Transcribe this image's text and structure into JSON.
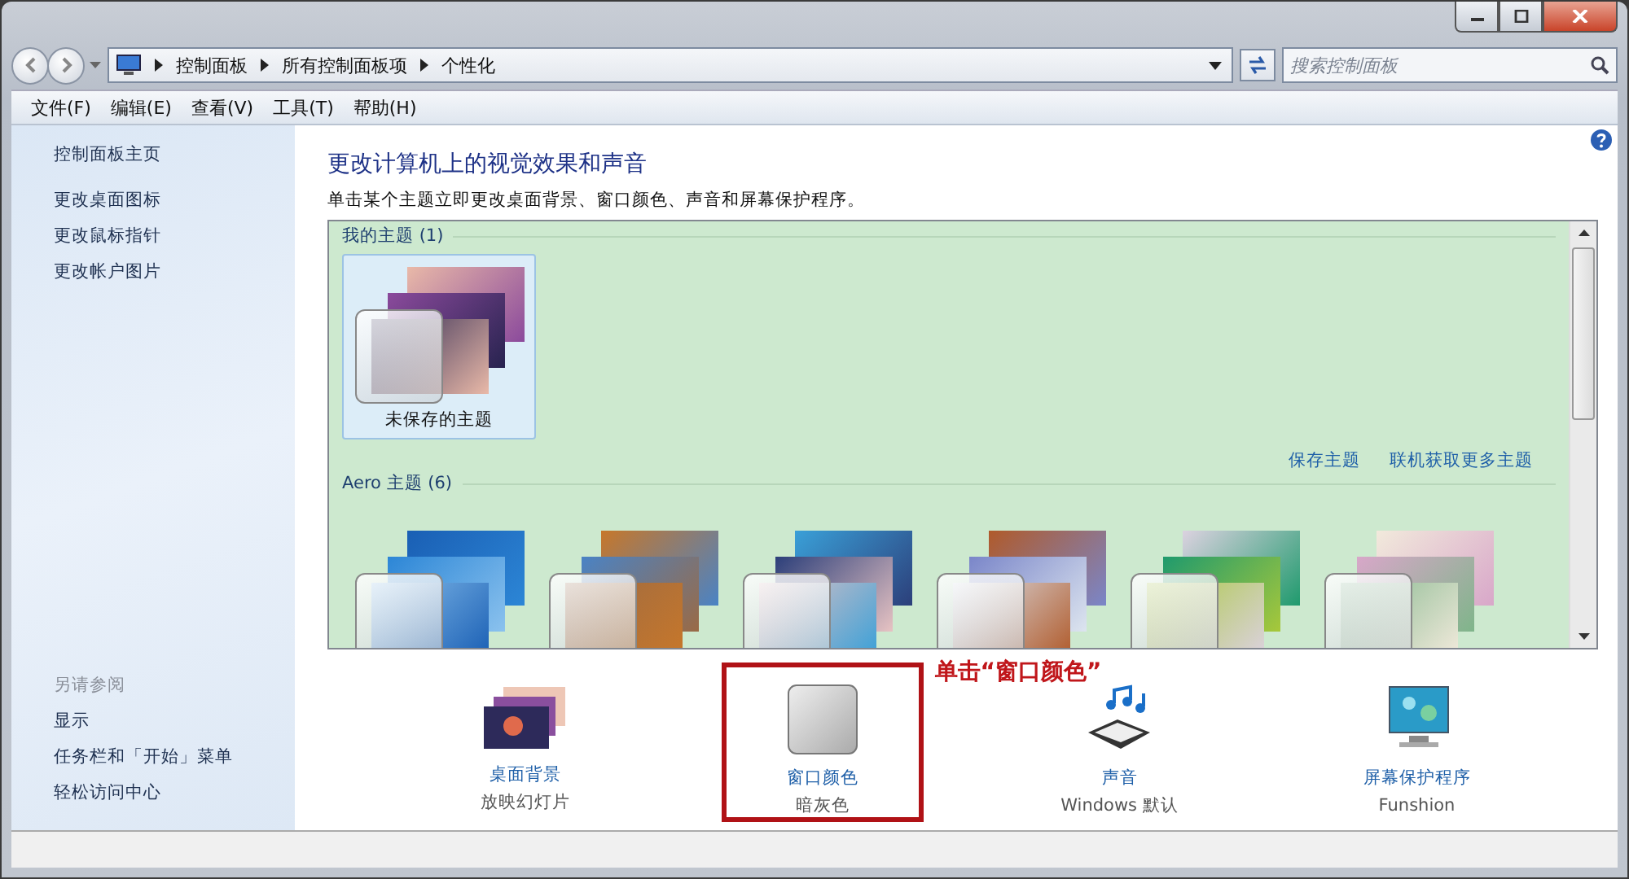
{
  "address_bar": {
    "crumbs": [
      "控制面板",
      "所有控制面板项",
      "个性化"
    ],
    "search_placeholder": "搜索控制面板"
  },
  "menu": [
    "文件(F)",
    "编辑(E)",
    "查看(V)",
    "工具(T)",
    "帮助(H)"
  ],
  "sidebar": {
    "home": "控制面板主页",
    "links": [
      "更改桌面图标",
      "更改鼠标指针",
      "更改帐户图片"
    ],
    "see_also_title": "另请参阅",
    "see_also": [
      "显示",
      "任务栏和「开始」菜单",
      "轻松访问中心"
    ]
  },
  "main": {
    "title": "更改计算机上的视觉效果和声音",
    "subtitle": "单击某个主题立即更改桌面背景、窗口颜色、声音和屏幕保护程序。",
    "groups": [
      {
        "title": "我的主题 (1)",
        "themes": [
          {
            "label": "未保存的主题",
            "selected": true
          }
        ],
        "links": [
          "保存主题",
          "联机获取更多主题"
        ]
      },
      {
        "title": "Aero 主题 (6)",
        "themes": [
          {
            "selected": false
          },
          {
            "selected": false
          },
          {
            "selected": false
          },
          {
            "selected": false
          },
          {
            "selected": false
          },
          {
            "selected": false
          }
        ]
      }
    ]
  },
  "settings": [
    {
      "kind": "wallpaper",
      "label": "桌面背景",
      "value": "放映幻灯片",
      "highlighted": false
    },
    {
      "kind": "color",
      "label": "窗口颜色",
      "value": "暗灰色",
      "highlighted": true
    },
    {
      "kind": "sound",
      "label": "声音",
      "value": "Windows 默认",
      "highlighted": false
    },
    {
      "kind": "screensaver",
      "label": "屏幕保护程序",
      "value": "Funshion",
      "highlighted": false
    }
  ],
  "callout": "单击“窗口颜色”"
}
